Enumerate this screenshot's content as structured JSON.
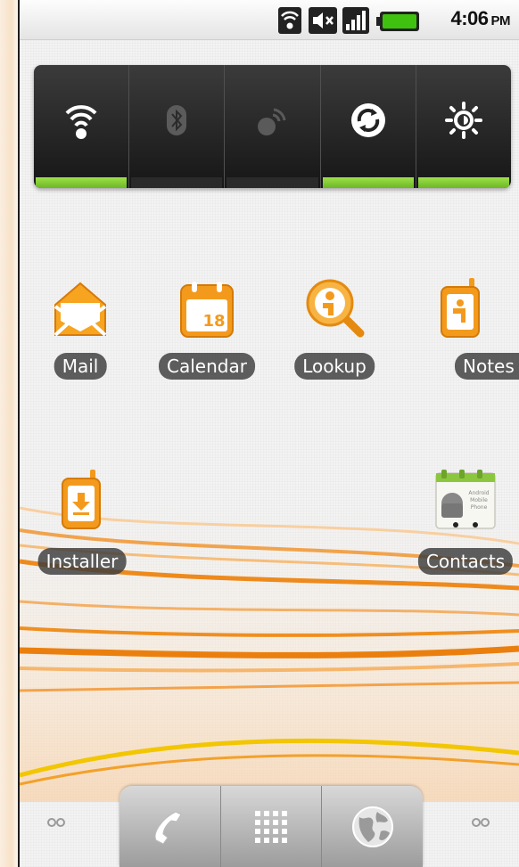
{
  "status_bar": {
    "time": "4:06",
    "ampm": "PM",
    "icons": [
      "wifi-icon",
      "volume-muted-icon",
      "signal-icon",
      "battery-icon"
    ]
  },
  "power_control": {
    "toggles": [
      {
        "name": "wifi",
        "icon": "wifi-icon",
        "on": true
      },
      {
        "name": "bluetooth",
        "icon": "bluetooth-icon",
        "on": false
      },
      {
        "name": "gps",
        "icon": "gps-icon",
        "on": false
      },
      {
        "name": "sync",
        "icon": "sync-icon",
        "on": true
      },
      {
        "name": "brightness",
        "icon": "brightness-icon",
        "on": true
      }
    ],
    "on_color": "#7cc52e"
  },
  "apps": {
    "mail": "Mail",
    "calendar": "Calendar",
    "calendar_day": "18",
    "lookup": "Lookup",
    "notes": "Notes Trav",
    "installer": "Installer",
    "contacts": "Contacts",
    "contacts_card_text": [
      "Android",
      "Mobile",
      "Phone"
    ]
  },
  "dock": {
    "buttons": [
      "phone-icon",
      "app-drawer-icon",
      "browser-icon"
    ]
  },
  "colors": {
    "accent_orange": "#f39c1e",
    "label_bg": "#3c3c3c"
  }
}
